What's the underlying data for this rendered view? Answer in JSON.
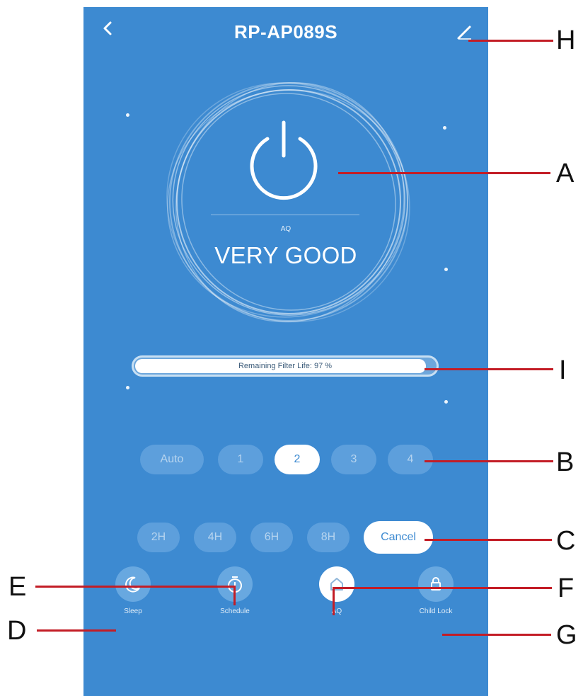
{
  "header": {
    "title": "RP-AP089S"
  },
  "air_quality": {
    "label": "AQ",
    "status": "VERY GOOD"
  },
  "filter": {
    "text": "Remaining Filter Life:  97 %",
    "percent": 97
  },
  "fan_speeds": [
    {
      "label": "Auto",
      "active": false
    },
    {
      "label": "1",
      "active": false
    },
    {
      "label": "2",
      "active": true
    },
    {
      "label": "3",
      "active": false
    },
    {
      "label": "4",
      "active": false
    }
  ],
  "timers": [
    {
      "label": "2H",
      "active": false
    },
    {
      "label": "4H",
      "active": false
    },
    {
      "label": "6H",
      "active": false
    },
    {
      "label": "8H",
      "active": false
    },
    {
      "label": "Cancel",
      "active": true
    }
  ],
  "bottom_nav": [
    {
      "label": "Sleep",
      "icon": "moon-icon"
    },
    {
      "label": "Schedule",
      "icon": "timer-icon"
    },
    {
      "label": "AQ",
      "icon": "home-icon",
      "active": true
    },
    {
      "label": "Child Lock",
      "icon": "lock-icon"
    }
  ],
  "callouts": {
    "A": "A",
    "B": "B",
    "C": "C",
    "D": "D",
    "E": "E",
    "F": "F",
    "G": "G",
    "H": "H",
    "I": "I"
  },
  "colors": {
    "background": "#3d8ad1",
    "callout_line": "#c31d26",
    "pill_inactive": "#5d9fdc",
    "pill_active": "#ffffff"
  }
}
